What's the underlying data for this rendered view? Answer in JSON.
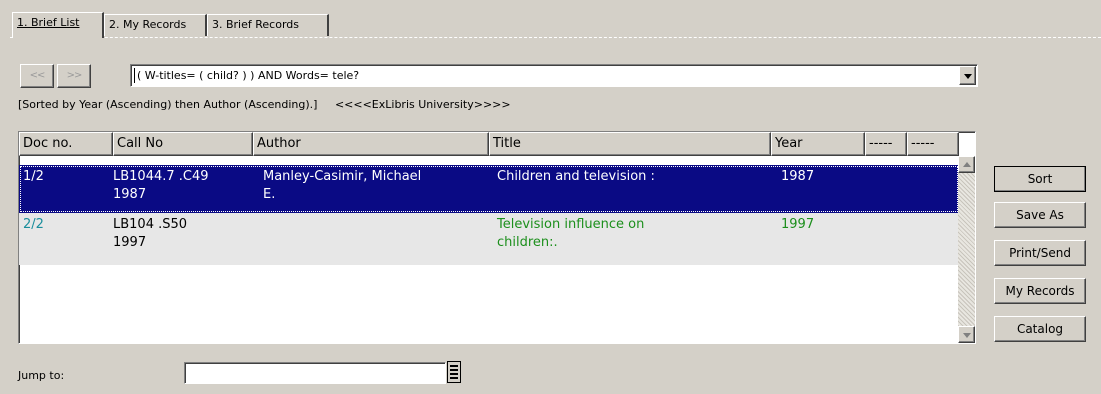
{
  "tabs": [
    {
      "label": "1. Brief List",
      "active": true
    },
    {
      "label": "2. My Records",
      "active": false
    },
    {
      "label": "3. Brief Records",
      "active": false
    }
  ],
  "nav": {
    "prev_label": "<<",
    "next_label": ">>"
  },
  "query": {
    "value": "( W-titles= ( child? ) ) AND Words= tele?"
  },
  "sort_info": {
    "text": "[Sorted by Year (Ascending) then Author (Ascending).]",
    "library": "<<<<ExLibris University>>>>"
  },
  "table": {
    "columns": [
      "Doc no.",
      "Call No",
      "Author",
      "Title",
      "Year",
      "-----",
      "-----"
    ],
    "rows": [
      {
        "doc": "1/2",
        "call_line1": "LB1044.7 .C49",
        "call_line2": "1987",
        "author_line1": "Manley-Casimir, Michael",
        "author_line2": "E.",
        "title_line1": "Children and television :",
        "title_line2": "",
        "year": "1987",
        "selected": true
      },
      {
        "doc": "2/2",
        "call_line1": "LB104 .S50",
        "call_line2": "1997",
        "author_line1": "",
        "author_line2": "",
        "title_line1": "Television influence on",
        "title_line2": "children:.",
        "year": "1997",
        "selected": false
      }
    ]
  },
  "actions": {
    "sort": "Sort",
    "save_as": "Save As",
    "print_send": "Print/Send",
    "my_records": "My Records",
    "catalog": "Catalog"
  },
  "jump": {
    "label": "Jump to:",
    "value": ""
  },
  "colors": {
    "selection": "#0a0a84",
    "doc_link": "#1a8e9c",
    "title_link": "#1c8f1c",
    "window_bg": "#d4d0c8"
  }
}
